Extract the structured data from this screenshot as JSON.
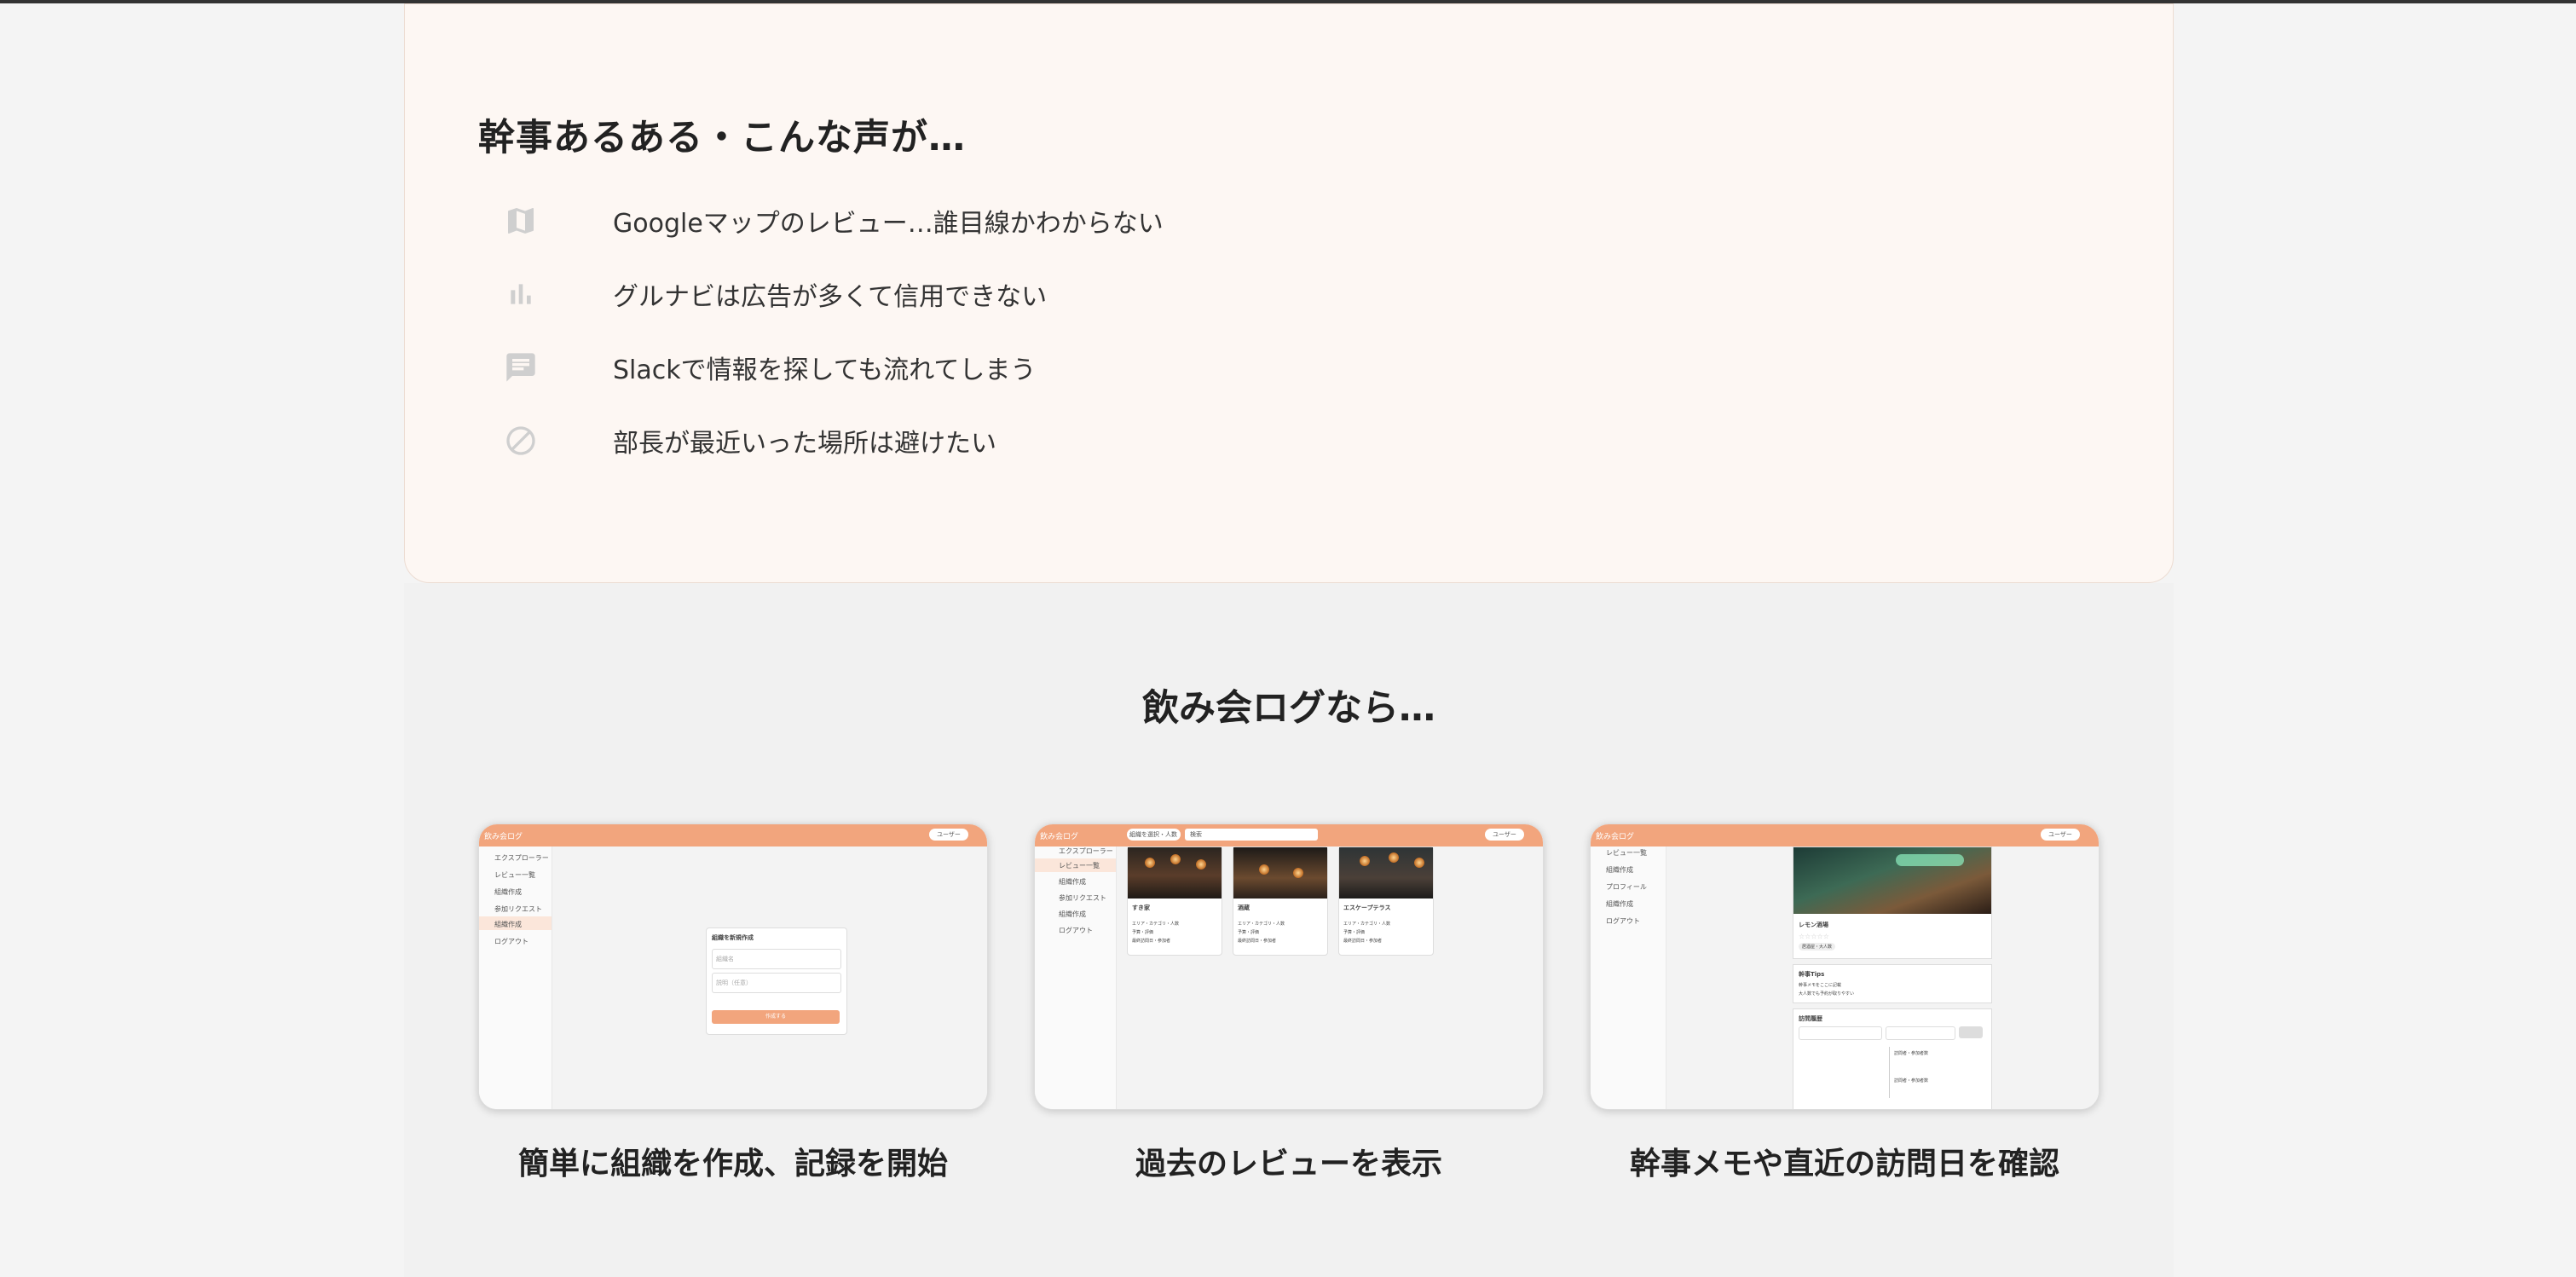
{
  "problems": {
    "title": "幹事あるある・こんな声が…",
    "items": [
      {
        "icon": "map-icon",
        "text": "Googleマップのレビュー…誰目線かわからない"
      },
      {
        "icon": "bar-chart-icon",
        "text": "グルナビは広告が多くて信用できない"
      },
      {
        "icon": "chat-icon",
        "text": "Slackで情報を探しても流れてしまう"
      },
      {
        "icon": "block-icon",
        "text": "部長が最近いった場所は避けたい"
      }
    ]
  },
  "solution": {
    "title": "飲み会ログなら…",
    "features": [
      {
        "caption": "簡単に組織を作成、記録を開始",
        "screen": {
          "logo": "飲み会ログ",
          "user": "ユーザー",
          "nav": [
            "エクスプローラー",
            "レビュー一覧",
            "組織作成",
            "参加リクエスト",
            "組織作成",
            "ログアウト"
          ],
          "form_title": "組織を新規作成",
          "field1": "組織名",
          "field2": "説明（任意）",
          "submit": "作成する"
        }
      },
      {
        "caption": "過去のレビューを表示",
        "screen": {
          "logo": "飲み会ログ",
          "org": "組織を選択・人数",
          "search": "検索",
          "user": "ユーザー",
          "nav": [
            "エクスプローラー",
            "レビュー一覧",
            "組織作成",
            "参加リクエスト",
            "組織作成",
            "ログアウト"
          ],
          "cards": [
            {
              "name": "すき家",
              "lines": [
                "エリア・カテゴリ・人数",
                "予算・評価",
                "最終訪問日・参加者"
              ]
            },
            {
              "name": "酒蔵",
              "lines": [
                "エリア・カテゴリ・人数",
                "予算・評価",
                "最終訪問日・参加者"
              ]
            },
            {
              "name": "エスケープテラス",
              "lines": [
                "エリア・カテゴリ・人数",
                "予算・評価",
                "最終訪問日・参加者"
              ]
            }
          ]
        }
      },
      {
        "caption": "幹事メモや直近の訪問日を確認",
        "screen": {
          "logo": "飲み会ログ",
          "user": "ユーザー",
          "nav": [
            "レビュー一覧",
            "組織作成",
            "プロフィール",
            "組織作成",
            "ログアウト"
          ],
          "shop_name": "レモン酒場",
          "tag": "居酒屋・大人数",
          "tips_title": "幹事Tips",
          "tips_lines": [
            "幹事メモをここに記載",
            "大人数でも予約が取りやすい"
          ],
          "history_title": "訪問履歴",
          "history_rows": [
            "訪問者・参加者数",
            "訪問者・参加者数"
          ]
        }
      }
    ]
  },
  "colors": {
    "accent": "#f2a57d",
    "card_bg": "#fdf7f3",
    "icon": "#cfcfcf"
  }
}
